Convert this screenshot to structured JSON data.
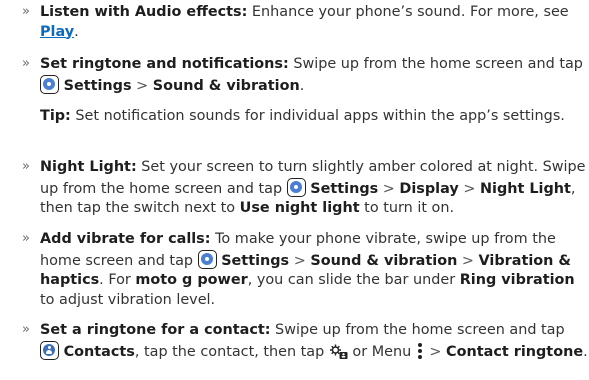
{
  "bullet_glyph": "»",
  "gt": ">",
  "sections": {
    "audio": {
      "lead": "Listen with Audio effects:",
      "text": " Enhance your phone’s sound. For more, see ",
      "link": "Play",
      "end": "."
    },
    "ringtone": {
      "lead": "Set ringtone and notifications:",
      "text": " Swipe up from the home screen and tap ",
      "settings": "Settings",
      "sound": "Sound & vibration",
      "end": "."
    },
    "tip": {
      "lead": "Tip:",
      "text": " Set notification sounds for individual apps within the app’s settings."
    },
    "night": {
      "lead": "Night Light:",
      "text1": " Set your screen to turn slightly amber colored at night. Swipe up from the home screen and tap ",
      "settings": "Settings",
      "display": "Display",
      "nightlight": "Night Light",
      "text2": ", then tap the switch next to ",
      "usenight": "Use night light",
      "text3": " to turn it on."
    },
    "vibrate": {
      "lead": "Add vibrate for calls:",
      "text1": " To make your phone vibrate, swipe up from the home screen and tap ",
      "settings": "Settings",
      "sound": "Sound & vibration",
      "vibration": "Vibration & haptics",
      "text2": ". For ",
      "model": "moto g power",
      "text3": ", you can slide the bar under ",
      "ring": "Ring vibration",
      "text4": " to adjust vibration level."
    },
    "contact": {
      "lead": "Set a ringtone for a contact:",
      "text1": " Swipe up from the home screen and tap ",
      "contacts": "Contacts",
      "text2": ", tap the contact, then tap ",
      "text3": " or Menu ",
      "contactringtone": "Contact ringtone",
      "end": "."
    }
  },
  "icons": {
    "settings": "settings-app-icon",
    "contacts": "contacts-app-icon",
    "contact_settings": "contact-settings-icon",
    "menu": "menu-dots-icon"
  },
  "colors": {
    "link": "#0c6bbd",
    "settings_icon": "#4a7fd1",
    "contacts_icon": "#3d6fb8",
    "text": "#333333"
  }
}
